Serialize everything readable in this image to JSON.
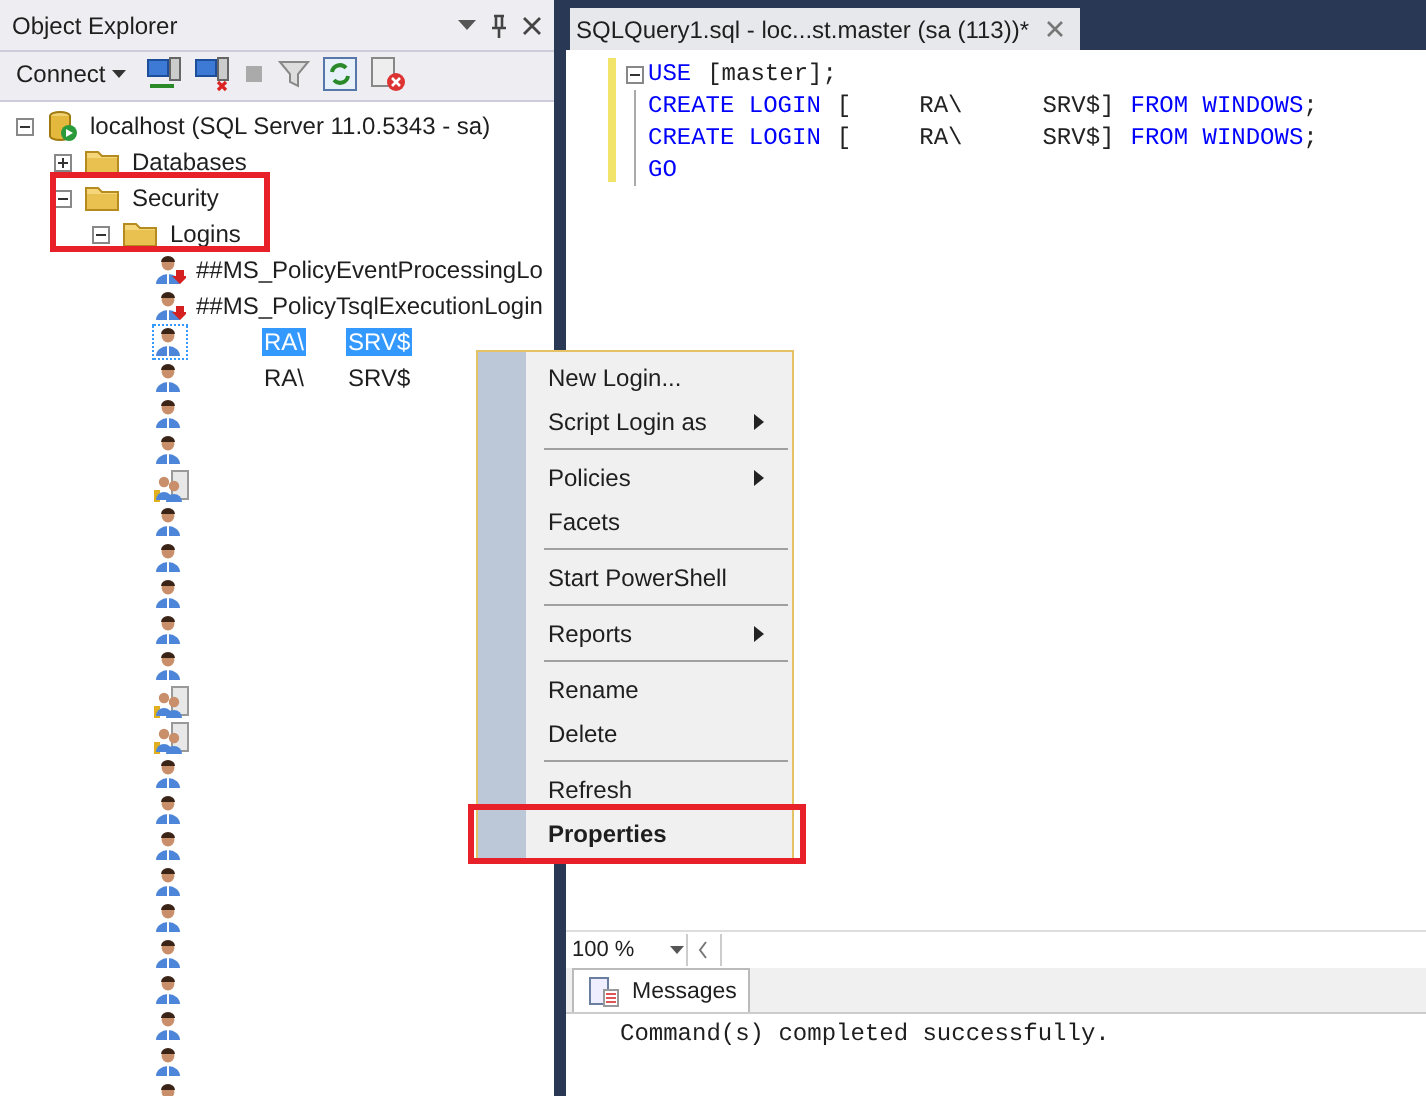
{
  "object_explorer": {
    "title": "Object Explorer",
    "connect_label": "Connect",
    "tree": {
      "label": "localhost (SQL Server 11.0.5343 - sa)",
      "kind": "server",
      "expanded": true,
      "children": [
        {
          "label": "Databases",
          "kind": "folder",
          "expanded": false
        },
        {
          "label": "Security",
          "kind": "folder",
          "expanded": true,
          "children": [
            {
              "label": "Logins",
              "kind": "folder",
              "expanded": true
            }
          ]
        }
      ]
    },
    "logins": [
      {
        "kind": "user_disabled",
        "parts": [
          "##MS_PolicyEventProcessingLo"
        ],
        "selected": false
      },
      {
        "kind": "user_disabled",
        "parts": [
          "##MS_PolicyTsqlExecutionLogin"
        ],
        "selected": false
      },
      {
        "kind": "user",
        "parts": [
          "RA\\",
          "SRV$"
        ],
        "selected": true
      },
      {
        "kind": "user",
        "parts": [
          "RA\\",
          "SRV$"
        ],
        "selected": false
      },
      {
        "kind": "user",
        "selected": false
      },
      {
        "kind": "user",
        "selected": false
      },
      {
        "kind": "group",
        "selected": false
      },
      {
        "kind": "user",
        "selected": false
      },
      {
        "kind": "user",
        "selected": false
      },
      {
        "kind": "user",
        "selected": false
      },
      {
        "kind": "user",
        "selected": false
      },
      {
        "kind": "user",
        "selected": false
      },
      {
        "kind": "group",
        "selected": false
      },
      {
        "kind": "group",
        "selected": false
      },
      {
        "kind": "user",
        "selected": false
      },
      {
        "kind": "user",
        "selected": false
      },
      {
        "kind": "user",
        "selected": false
      },
      {
        "kind": "user",
        "selected": false
      },
      {
        "kind": "user",
        "selected": false
      },
      {
        "kind": "user",
        "selected": false
      },
      {
        "kind": "user",
        "selected": false
      },
      {
        "kind": "user",
        "selected": false
      },
      {
        "kind": "user",
        "selected": false
      },
      {
        "kind": "user",
        "selected": false
      }
    ]
  },
  "editor": {
    "tab_title": "SQLQuery1.sql - loc...st.master (sa (113))*",
    "lines": [
      {
        "tokens": [
          {
            "kind": "keyword",
            "text": "USE"
          },
          {
            "kind": "plain",
            "text": "[master];"
          }
        ]
      },
      {
        "tokens": [
          {
            "kind": "keyword",
            "text": "CREATE LOGIN"
          },
          {
            "kind": "plain",
            "text": "["
          },
          {
            "kind": "plain",
            "text": "RA\\"
          },
          {
            "kind": "plain",
            "text": "SRV$]"
          },
          {
            "kind": "keyword",
            "text": "FROM WINDOWS"
          },
          {
            "kind": "plain",
            "text": ";"
          }
        ]
      },
      {
        "tokens": [
          {
            "kind": "keyword",
            "text": "CREATE LOGIN"
          },
          {
            "kind": "plain",
            "text": "["
          },
          {
            "kind": "plain",
            "text": "RA\\"
          },
          {
            "kind": "plain",
            "text": "SRV$]"
          },
          {
            "kind": "keyword",
            "text": "FROM WINDOWS"
          },
          {
            "kind": "plain",
            "text": ";"
          }
        ]
      },
      {
        "tokens": [
          {
            "kind": "keyword",
            "text": "GO"
          }
        ]
      }
    ],
    "zoom": "100 %",
    "results_tab": "Messages",
    "message": "Command(s) completed successfully."
  },
  "context_menu": [
    {
      "kind": "item",
      "label": "New Login...",
      "submenu": false,
      "default": false
    },
    {
      "kind": "item",
      "label": "Script Login as",
      "submenu": true,
      "default": false
    },
    {
      "kind": "separator"
    },
    {
      "kind": "item",
      "label": "Policies",
      "submenu": true,
      "default": false
    },
    {
      "kind": "item",
      "label": "Facets",
      "submenu": false,
      "default": false
    },
    {
      "kind": "separator"
    },
    {
      "kind": "item",
      "label": "Start PowerShell",
      "submenu": false,
      "default": false
    },
    {
      "kind": "separator"
    },
    {
      "kind": "item",
      "label": "Reports",
      "submenu": true,
      "default": false
    },
    {
      "kind": "separator"
    },
    {
      "kind": "item",
      "label": "Rename",
      "submenu": false,
      "default": false
    },
    {
      "kind": "item",
      "label": "Delete",
      "submenu": false,
      "default": false
    },
    {
      "kind": "separator"
    },
    {
      "kind": "item",
      "label": "Refresh",
      "submenu": false,
      "default": false
    },
    {
      "kind": "item",
      "label": "Properties",
      "submenu": false,
      "default": true
    }
  ]
}
